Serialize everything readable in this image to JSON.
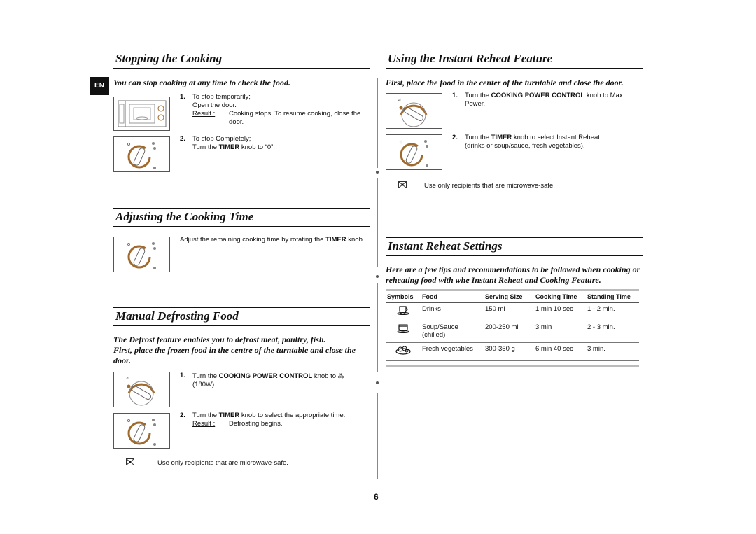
{
  "page": {
    "language_badge": "EN",
    "page_number": "6"
  },
  "stopping": {
    "title": "Stopping the Cooking",
    "intro": "You can stop cooking at any time to check the food.",
    "step1": {
      "num": "1.",
      "line1": "To stop temporarily;",
      "line2": "Open the door.",
      "result_label": "Result :",
      "result_text": "Cooking stops. To resume cooking, close the door."
    },
    "step2": {
      "num": "2.",
      "line1": "To stop Completely;",
      "line2_pre": "Turn the ",
      "line2_bold": "TIMER",
      "line2_post": " knob to “0”."
    }
  },
  "adjusting": {
    "title": "Adjusting the Cooking Time",
    "text_pre": "Adjust the remaining cooking time by rotating the ",
    "text_bold": "TIMER",
    "text_post": " knob."
  },
  "defrost": {
    "title": "Manual Defrosting Food",
    "intro1": "The Defrost feature enables you to defrost meat, poultry, fish.",
    "intro2": "First, place the frozen food in the centre of the turntable and close the door.",
    "step1": {
      "num": "1.",
      "pre": "Turn the ",
      "bold": "COOKING POWER CONTROL",
      "post": " knob to ",
      "icon": "defrost-symbol-icon",
      "line2": "(180W)."
    },
    "step2": {
      "num": "2.",
      "pre": "Turn the ",
      "bold": "TIMER",
      "post": " knob to select the appropriate time.",
      "result_label": "Result :",
      "result_text": "Defrosting begins."
    },
    "note": "Use only recipients that are microwave-safe."
  },
  "reheat": {
    "title": "Using the Instant Reheat Feature",
    "intro": "First, place the food in the center of the turntable and close the door.",
    "step1": {
      "num": "1.",
      "pre": "Turn the ",
      "bold": "COOKING POWER CONTROL",
      "post": " knob to Max Power."
    },
    "step2": {
      "num": "2.",
      "pre": "Turn the ",
      "bold": "TIMER",
      "post": " knob to select Instant Reheat.",
      "line2": "(drinks or soup/sauce, fresh vegetables)."
    },
    "note": "Use only recipients that are microwave-safe."
  },
  "settings": {
    "title": "Instant Reheat Settings",
    "intro": "Here are a few tips and recommendations to be followed when cooking or reheating food with whe Instant Reheat and Cooking Feature.",
    "headers": [
      "Symbols",
      "Food",
      "Serving Size",
      "Cooking Time",
      "Standing Time"
    ],
    "rows": [
      {
        "icon": "cup-icon",
        "food": "Drinks",
        "size": "150 ml",
        "cook": "1 min 10 sec",
        "stand": "1 - 2 min."
      },
      {
        "icon": "bowl-icon",
        "food": "Soup/Sauce (chilled)",
        "size": "200-250 ml",
        "cook": "3 min",
        "stand": "2 - 3 min."
      },
      {
        "icon": "vegetables-plate-icon",
        "food": "Fresh vegetables",
        "size": "300-350 g",
        "cook": "6 min 40 sec",
        "stand": "3 min."
      }
    ]
  },
  "colors": {
    "knob_ring": "#a06a2c"
  }
}
